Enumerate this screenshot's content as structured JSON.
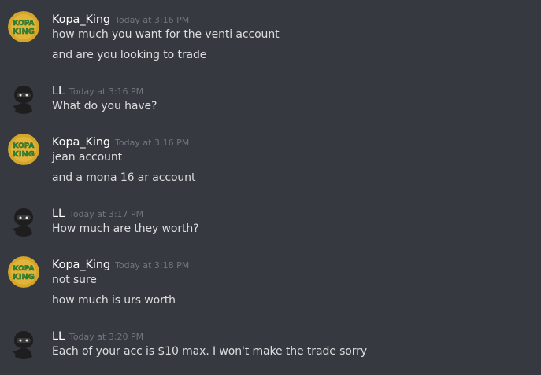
{
  "messages": [
    {
      "author": "Kopa_King",
      "avatar": "kopa-king-avatar",
      "timestamp": "Today at 3:16 PM",
      "lines": [
        "how much you want for the venti account",
        "and are you looking to trade"
      ]
    },
    {
      "author": "LL",
      "avatar": "ninja-avatar",
      "timestamp": "Today at 3:16 PM",
      "lines": [
        "What do you have?"
      ]
    },
    {
      "author": "Kopa_King",
      "avatar": "kopa-king-avatar",
      "timestamp": "Today at 3:16 PM",
      "lines": [
        "jean account",
        "and a mona 16 ar account"
      ]
    },
    {
      "author": "LL",
      "avatar": "ninja-avatar",
      "timestamp": "Today at 3:17 PM",
      "lines": [
        "How much are they worth?"
      ]
    },
    {
      "author": "Kopa_King",
      "avatar": "kopa-king-avatar",
      "timestamp": "Today at 3:18 PM",
      "lines": [
        "not sure",
        "how much is urs worth"
      ]
    },
    {
      "author": "LL",
      "avatar": "ninja-avatar",
      "timestamp": "Today at 3:20 PM",
      "lines": [
        "Each of your acc is $10 max. I won't make the trade sorry"
      ]
    }
  ],
  "avatar_logo_text": [
    "KOPA",
    "KING"
  ],
  "colors": {
    "background": "#36393f",
    "username": "#ffffff",
    "message_text": "#dcddde",
    "timestamp": "#72767d",
    "kopa_avatar_bg": "#d4a62a",
    "kopa_avatar_text": "#2b8c3a",
    "ninja_avatar_bg": "#36393f"
  }
}
